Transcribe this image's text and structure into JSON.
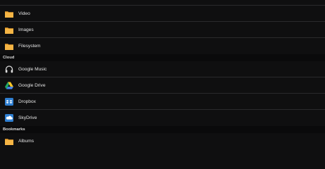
{
  "sections": [
    {
      "title": "",
      "items": [
        {
          "label": "Video",
          "icon": "folder-icon"
        },
        {
          "label": "Images",
          "icon": "folder-icon"
        },
        {
          "label": "Filesystem",
          "icon": "folder-icon"
        }
      ]
    },
    {
      "title": "Cloud",
      "items": [
        {
          "label": "Google Music",
          "icon": "headphones-icon"
        },
        {
          "label": "Google Drive",
          "icon": "google-drive-icon"
        },
        {
          "label": "Dropbox",
          "icon": "dropbox-icon"
        },
        {
          "label": "SkyDrive",
          "icon": "skydrive-icon"
        }
      ]
    },
    {
      "title": "Bookmarks",
      "items": [
        {
          "label": "Albums",
          "icon": "folder-icon"
        }
      ]
    }
  ],
  "colors": {
    "background": "#0f0f10",
    "folder": "#f0a531",
    "dropbox": "#2f7fd1",
    "skydrive": "#2f7fd1"
  }
}
